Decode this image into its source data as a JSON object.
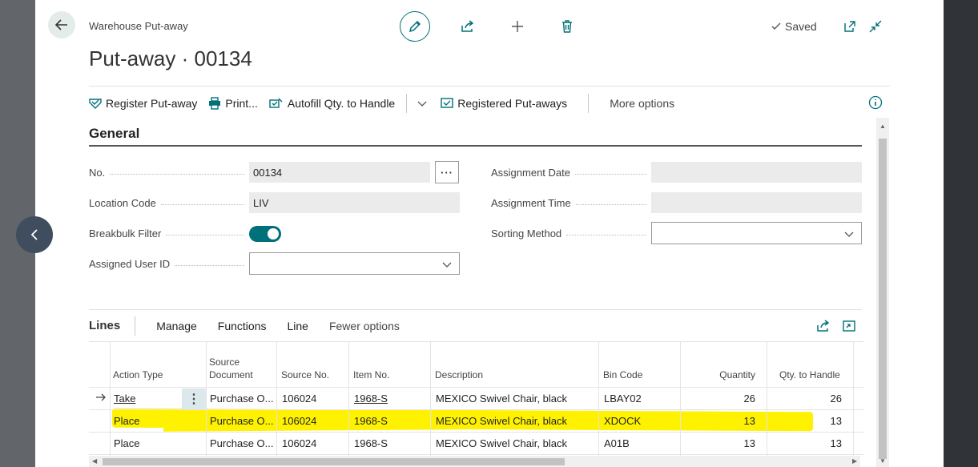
{
  "header": {
    "breadcrumb": "Warehouse Put-away",
    "title": "Put-away · 00134",
    "status": "Saved"
  },
  "icons": {
    "back": "arrow-left-icon",
    "edit": "pencil-icon",
    "share": "share-icon",
    "add": "plus-icon",
    "delete": "trash-icon",
    "saved": "check-icon",
    "open_new": "open-in-new-window-icon",
    "collapse": "collapse-icon",
    "info": "info-icon"
  },
  "actions": {
    "register": "Register Put-away",
    "print": "Print...",
    "autofill": "Autofill Qty. to Handle",
    "registered": "Registered Put-aways",
    "more": "More options"
  },
  "general": {
    "title": "General",
    "no_label": "No.",
    "no_value": "00134",
    "location_label": "Location Code",
    "location_value": "LIV",
    "breakbulk_label": "Breakbulk Filter",
    "breakbulk_on": true,
    "assigned_user_label": "Assigned User ID",
    "assigned_user_value": "",
    "assignment_date_label": "Assignment Date",
    "assignment_date_value": "",
    "assignment_time_label": "Assignment Time",
    "assignment_time_value": "",
    "sorting_label": "Sorting Method",
    "sorting_value": ""
  },
  "lines": {
    "title": "Lines",
    "menu": [
      "Manage",
      "Functions",
      "Line"
    ],
    "fewer": "Fewer options",
    "columns": {
      "action_type": "Action Type",
      "source_document_1": "Source",
      "source_document_2": "Document",
      "source_no": "Source No.",
      "item_no": "Item No.",
      "description": "Description",
      "bin_code": "Bin Code",
      "quantity": "Quantity",
      "qty_to_handle": "Qty. to Handle"
    },
    "rows": [
      {
        "action_type": "Take",
        "source_document": "Purchase O...",
        "source_no": "106024",
        "item_no": "1968-S",
        "description": "MEXICO Swivel Chair, black",
        "bin_code": "LBAY02",
        "quantity": "26",
        "qty_to_handle": "26"
      },
      {
        "action_type": "Place",
        "source_document": "Purchase O...",
        "source_no": "106024",
        "item_no": "1968-S",
        "description": "MEXICO Swivel Chair, black",
        "bin_code": "XDOCK",
        "quantity": "13",
        "qty_to_handle": "13"
      },
      {
        "action_type": "Place",
        "source_document": "Purchase O...",
        "source_no": "106024",
        "item_no": "1968-S",
        "description": "MEXICO Swivel Chair, black",
        "bin_code": "A01B",
        "quantity": "13",
        "qty_to_handle": "13"
      }
    ]
  }
}
